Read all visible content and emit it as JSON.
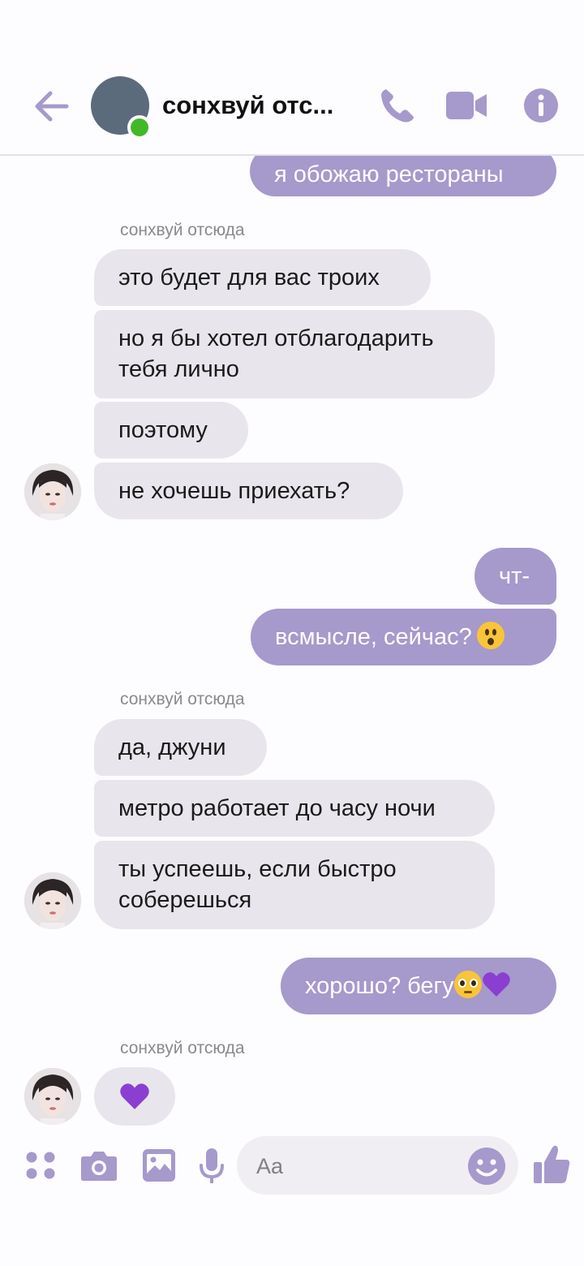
{
  "header": {
    "contact_name": "сонхвуй отс...",
    "icons": [
      "back-arrow-icon",
      "phone-icon",
      "video-camera-icon",
      "info-icon"
    ]
  },
  "colors": {
    "accent": "#a699cc",
    "incoming_bubble": "#e8e6ec",
    "online": "#42b72a"
  },
  "messages": {
    "m1": "я обожаю рестораны",
    "group1_sender": "сонхвуй отсюда",
    "m2": "это будет для вас троих",
    "m3_line1": "но я бы хотел отблагодарить",
    "m3_line2": "тебя лично",
    "m4": "поэтому",
    "m5": "не хочешь приехать?",
    "m6": "чт-",
    "m7": "всмысле, сейчас?",
    "group2_sender": "сонхвуй отсюда",
    "m8": "да, джуни",
    "m9": "метро работает до часу ночи",
    "m10_line1": "ты успеешь, если быстро",
    "m10_line2": "соберешься",
    "m11": "хорошо? бегу",
    "group3_sender": "сонхвуй отсюда"
  },
  "composer": {
    "placeholder": "Aa",
    "icons": [
      "apps-icon",
      "camera-icon",
      "gallery-icon",
      "microphone-icon",
      "emoji-icon",
      "thumbs-up-icon"
    ]
  }
}
